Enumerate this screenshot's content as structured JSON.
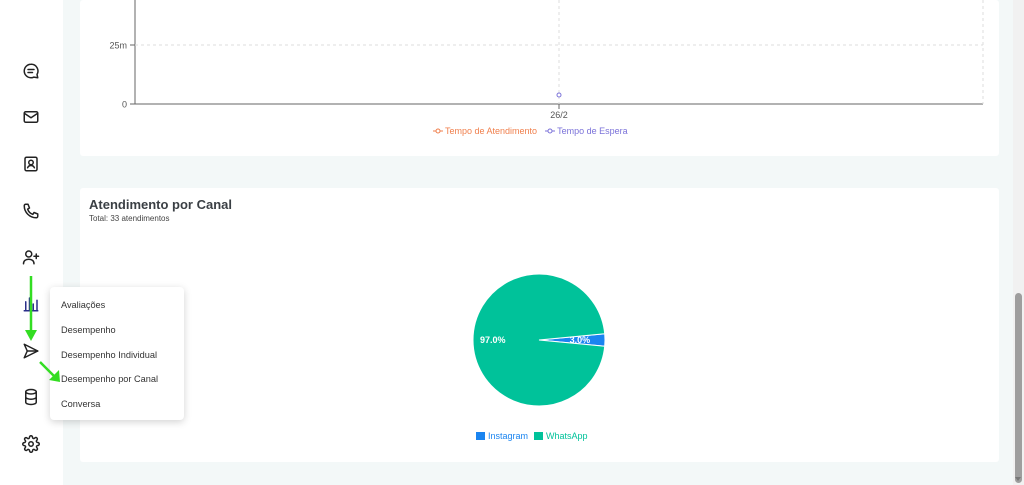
{
  "sidebar": {
    "items": [
      {
        "icon": "chat-icon"
      },
      {
        "icon": "mail-icon"
      },
      {
        "icon": "contact-card-icon"
      },
      {
        "icon": "phone-icon"
      },
      {
        "icon": "user-plus-icon"
      },
      {
        "icon": "bar-chart-icon"
      },
      {
        "icon": "send-icon"
      },
      {
        "icon": "database-icon"
      },
      {
        "icon": "gear-icon"
      }
    ]
  },
  "menu": {
    "items": [
      {
        "label": "Avaliações"
      },
      {
        "label": "Desempenho"
      },
      {
        "label": "Desempenho Individual"
      },
      {
        "label": "Desempenho por Canal"
      },
      {
        "label": "Conversa"
      }
    ]
  },
  "line_card": {
    "ytick_25": "25m",
    "ytick_0": "0",
    "xtick": "26/2",
    "legend": [
      {
        "label": "Tempo de Atendimento",
        "color": "#f07f4c"
      },
      {
        "label": "Tempo de Espera",
        "color": "#7b72d9"
      }
    ]
  },
  "pie_card": {
    "title": "Atendimento por Canal",
    "subtitle": "Total: 33 atendimentos",
    "legend": [
      {
        "label": "Instagram",
        "color": "#1a84f0"
      },
      {
        "label": "WhatsApp",
        "color": "#00c29a"
      }
    ]
  },
  "chart_data": [
    {
      "type": "line",
      "x": [
        "26/2"
      ],
      "yticks": [
        "25m",
        "0"
      ],
      "series": [
        {
          "name": "Tempo de Atendimento",
          "color": "#f07f4c",
          "values": [
            null
          ]
        },
        {
          "name": "Tempo de Espera",
          "color": "#7b72d9",
          "values": [
            4
          ]
        }
      ],
      "grid": true,
      "legend": "bottom"
    },
    {
      "type": "pie",
      "title": "Atendimento por Canal",
      "subtitle": "Total: 33 atendimentos",
      "slices": [
        {
          "name": "Instagram",
          "value": 3.0,
          "label": "3.0%",
          "color": "#1a84f0"
        },
        {
          "name": "WhatsApp",
          "value": 97.0,
          "label": "97.0%",
          "color": "#00c29a"
        }
      ],
      "legend": "bottom"
    }
  ]
}
